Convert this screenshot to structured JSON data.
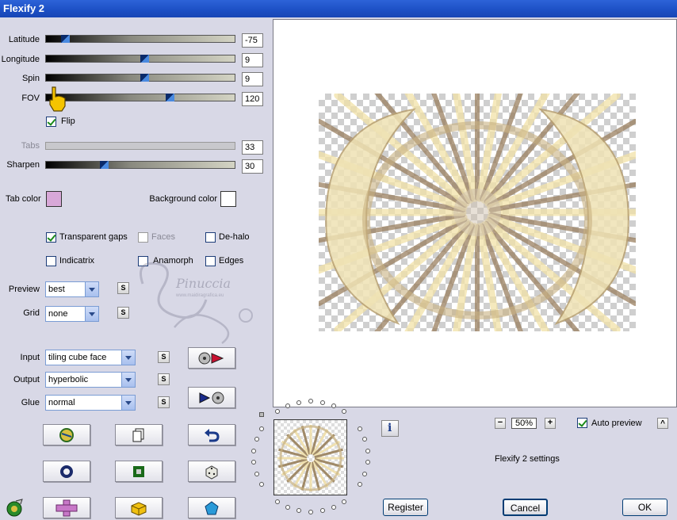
{
  "window": {
    "title": "Flexify 2"
  },
  "sliders": [
    {
      "label": "Latitude",
      "value": "-75",
      "level": 0.1
    },
    {
      "label": "Longitude",
      "value": "9",
      "level": 0.53
    },
    {
      "label": "Spin",
      "value": "9",
      "level": 0.53
    },
    {
      "label": "FOV",
      "value": "120",
      "level": 0.67
    }
  ],
  "flip": {
    "label": "Flip",
    "checked": true
  },
  "tabs": {
    "label": "Tabs",
    "value": "33",
    "enabled": false
  },
  "sharpen": {
    "label": "Sharpen",
    "value": "30",
    "level": 0.3
  },
  "colors": {
    "tab_label": "Tab color",
    "tab_color": "#d8a8d8",
    "bg_label": "Background color",
    "bg_color": "#ffffff"
  },
  "options": {
    "transparent_gaps": {
      "label": "Transparent gaps",
      "checked": true
    },
    "faces": {
      "label": "Faces",
      "checked": false,
      "enabled": false
    },
    "dehalo": {
      "label": "De-halo",
      "checked": false
    },
    "indicatrix": {
      "label": "Indicatrix",
      "checked": false
    },
    "anamorph": {
      "label": "Anamorph",
      "checked": false
    },
    "edges": {
      "label": "Edges",
      "checked": false
    }
  },
  "preview_select": {
    "label": "Preview",
    "value": "best"
  },
  "grid_select": {
    "label": "Grid",
    "value": "none"
  },
  "input_select": {
    "label": "Input",
    "value": "tiling cube face"
  },
  "output_select": {
    "label": "Output",
    "value": "hyperbolic"
  },
  "glue_select": {
    "label": "Glue",
    "value": "normal"
  },
  "s_label": "S",
  "zoom": {
    "value": "50%",
    "minus": "−",
    "plus": "+"
  },
  "auto_preview": {
    "label": "Auto preview",
    "checked": true
  },
  "settings_text": "Flexify 2 settings",
  "buttons": {
    "register": "Register",
    "cancel": "Cancel",
    "ok": "OK",
    "collapse": "^"
  },
  "watermark": {
    "name": "Pinuccia",
    "site": "www.maidiragrafica.eu"
  },
  "icons": [
    "sphere-icon",
    "page-icon",
    "undo-icon",
    "ring-icon",
    "square-icon",
    "dice-icon",
    "cross-icon",
    "cube-icon",
    "pentagon-icon",
    "tool-icon"
  ]
}
